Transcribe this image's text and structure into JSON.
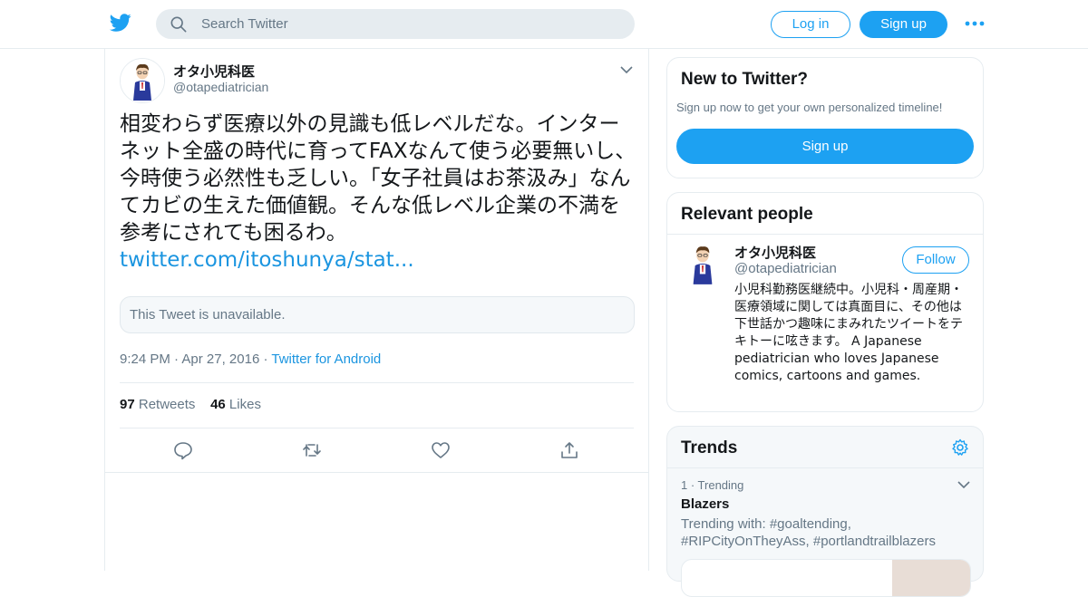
{
  "header": {
    "search_placeholder": "Search Twitter",
    "login_label": "Log in",
    "signup_label": "Sign up"
  },
  "tweet": {
    "author_name": "オタ小児科医",
    "author_handle": "@otapediatrician",
    "text": "相変わらず医療以外の見識も低レベルだな。インターネット全盛の時代に育ってFAXなんて使う必要無いし、今時使う必然性も乏しい。「女子社員はお茶汲み」なんてカビの生えた価値観。そんな低レベル企業の不満を参考にされても困るわ。",
    "link": "twitter.com/itoshunya/stat...",
    "quoted_unavailable": "This Tweet is unavailable.",
    "time": "9:24 PM",
    "dot": "·",
    "date": "Apr 27, 2016",
    "source": "Twitter for Android",
    "retweets_count": "97",
    "retweets_label": "Retweets",
    "likes_count": "46",
    "likes_label": "Likes"
  },
  "sidebar": {
    "new_title": "New to Twitter?",
    "new_sub": "Sign up now to get your own personalized timeline!",
    "new_signup": "Sign up",
    "relevant_title": "Relevant people",
    "person_name": "オタ小児科医",
    "person_handle": "@otapediatrician",
    "follow_label": "Follow",
    "person_bio": "小児科勤務医継続中。小児科・周産期・医療領域に関しては真面目に、その他は下世話かつ趣味にまみれたツイートをテキトーに呟きます。 A Japanese pediatrician who loves Japanese comics, cartoons and games.",
    "trends_title": "Trends",
    "trend_meta": "1 · Trending",
    "trend_name": "Blazers",
    "trend_with": "Trending with: #goaltending, #RIPCityOnTheyAss, #portlandtrailblazers"
  },
  "colors": {
    "brand": "#1da1f2",
    "link": "#1b95e0",
    "muted": "#657786"
  }
}
